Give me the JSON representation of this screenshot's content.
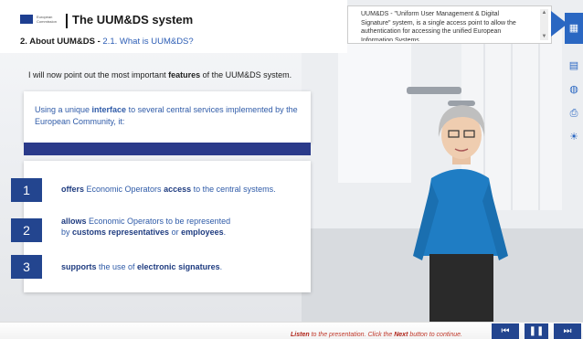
{
  "header": {
    "logo_text": "European Commission",
    "title": "The UUM&DS system",
    "section_main": "2. About UUM&DS - ",
    "section_sub": "2.1. What is UUM&DS?"
  },
  "intro": {
    "before": "I will now point out the most important ",
    "bold": "features",
    "after": " of the UUM&DS system."
  },
  "card1": {
    "before": "Using a unique ",
    "bold": "interface",
    "after": " to several central services implemented by the European Community, it:"
  },
  "rows": [
    {
      "num": "1",
      "t1": "offers",
      "t2": " Economic Operators ",
      "t3": "access",
      "t4": " to the central systems."
    },
    {
      "num": "2",
      "t1": "allows",
      "t2": " Economic Operators to be represented",
      "t3": "by ",
      "t4": "customs representatives",
      "t5": " or ",
      "t6": "employees",
      "t7": "."
    },
    {
      "num": "3",
      "t1": "supports",
      "t2": " the use of ",
      "t3": "electronic signatures",
      "t4": "."
    }
  ],
  "tooltip": {
    "text": "UUM&DS - \"Uniform User Management & Digital Signature\" system, is a single access point to allow the authentication for accessing the unified European Information Systems"
  },
  "bottom": {
    "listen": "Listen",
    "t1": " to the presentation. Click the ",
    "next": "Next",
    "t2": " button to continue."
  },
  "icons": [
    "menu-icon",
    "document-icon",
    "globe-icon",
    "printer-icon",
    "lightbulb-icon",
    "rewind-icon",
    "pause-icon",
    "fast-forward-icon"
  ],
  "colors": {
    "accent": "#2a67c2",
    "navy": "#23458f",
    "link": "#2f5ba8",
    "alert": "#c0392b"
  }
}
